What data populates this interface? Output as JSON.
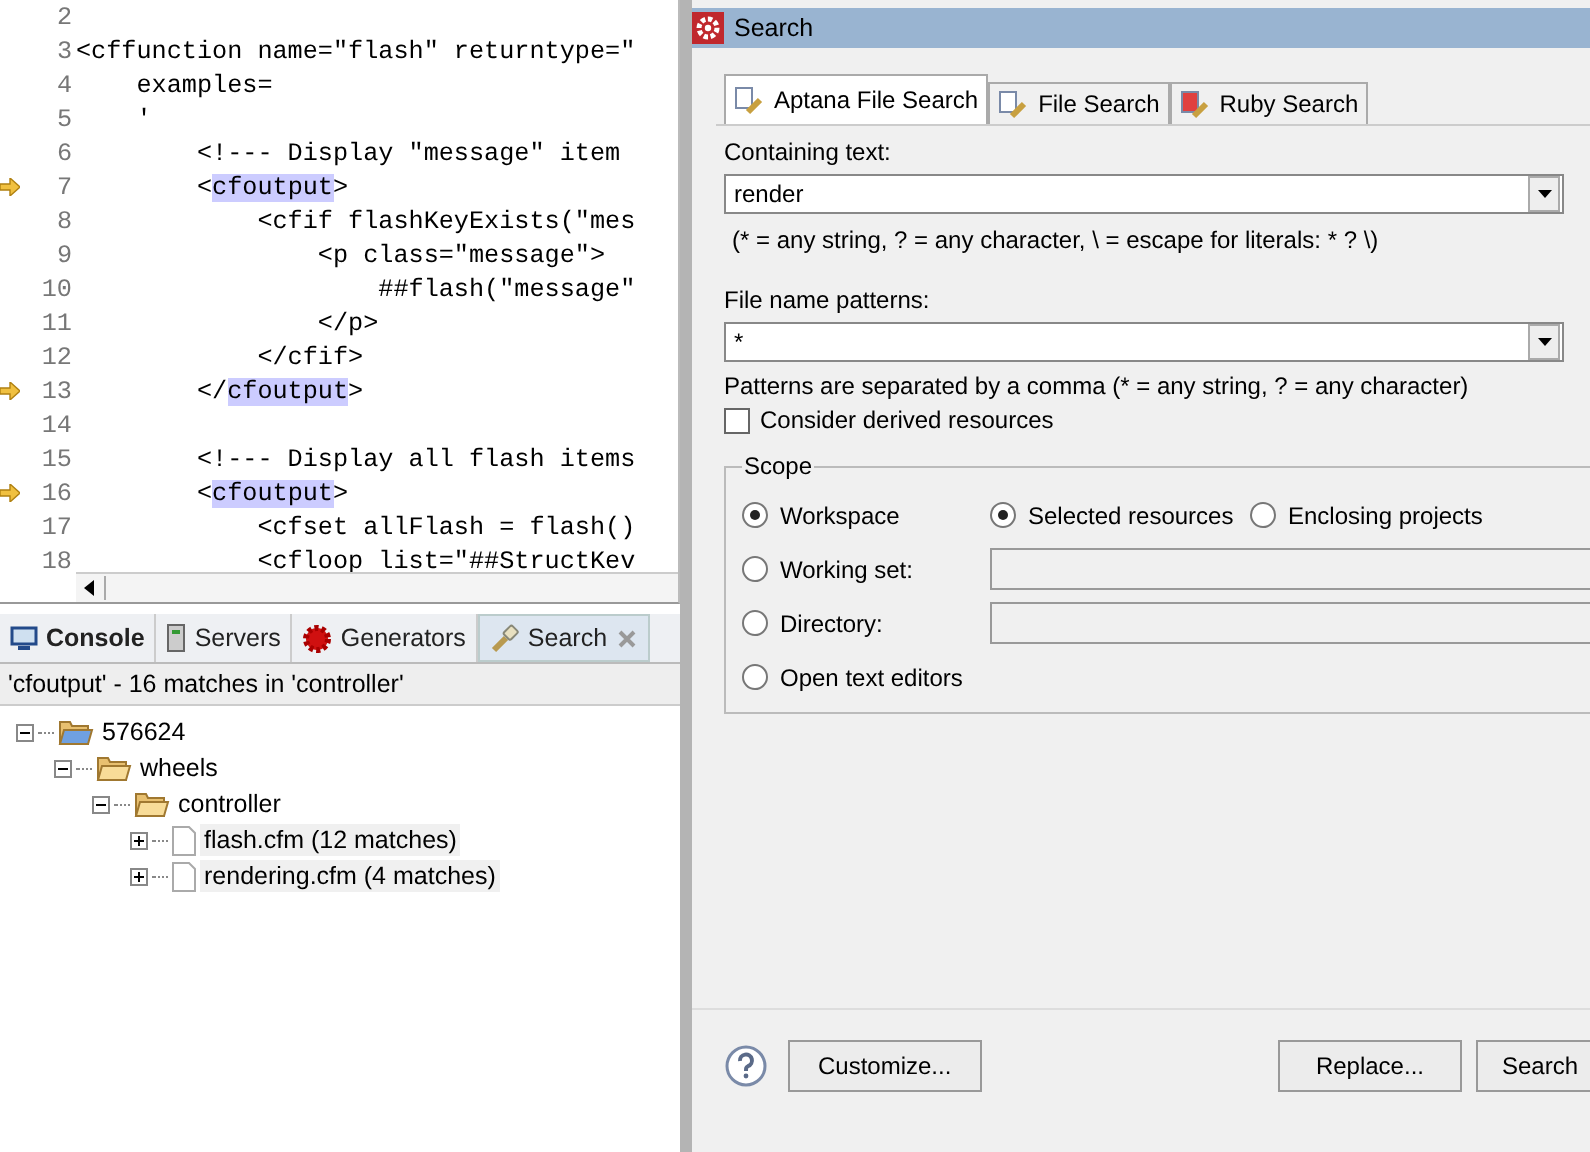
{
  "editor": {
    "lines": [
      {
        "num": "2",
        "marker": false
      },
      {
        "num": "3",
        "marker": false,
        "parts": [
          {
            "text": "<cffunction name=\"flash\" returntype=\"",
            "highlight": false
          }
        ]
      },
      {
        "num": "4",
        "marker": false,
        "parts": [
          {
            "text": "    examples=",
            "highlight": false
          }
        ]
      },
      {
        "num": "5",
        "marker": false,
        "parts": [
          {
            "text": "    '",
            "highlight": false
          }
        ]
      },
      {
        "num": "6",
        "marker": false,
        "parts": [
          {
            "text": "        <!--- Display \"message\" item",
            "highlight": false
          }
        ]
      },
      {
        "num": "7",
        "marker": true,
        "parts": [
          {
            "text": "        <",
            "highlight": false
          },
          {
            "text": "cfoutput",
            "highlight": true
          },
          {
            "text": ">",
            "highlight": false
          }
        ]
      },
      {
        "num": "8",
        "marker": false,
        "parts": [
          {
            "text": "            <cfif flashKeyExists(\"mes",
            "highlight": false
          }
        ]
      },
      {
        "num": "9",
        "marker": false,
        "parts": [
          {
            "text": "                <p class=\"message\">",
            "highlight": false
          }
        ]
      },
      {
        "num": "10",
        "marker": false,
        "parts": [
          {
            "text": "                    ##flash(\"message\"",
            "highlight": false
          }
        ]
      },
      {
        "num": "11",
        "marker": false,
        "parts": [
          {
            "text": "                </p>",
            "highlight": false
          }
        ]
      },
      {
        "num": "12",
        "marker": false,
        "parts": [
          {
            "text": "            </cfif>",
            "highlight": false
          }
        ]
      },
      {
        "num": "13",
        "marker": true,
        "parts": [
          {
            "text": "        </",
            "highlight": false
          },
          {
            "text": "cfoutput",
            "highlight": true
          },
          {
            "text": ">",
            "highlight": false
          }
        ]
      },
      {
        "num": "14",
        "marker": false
      },
      {
        "num": "15",
        "marker": false,
        "parts": [
          {
            "text": "        <!--- Display all flash items",
            "highlight": false
          }
        ]
      },
      {
        "num": "16",
        "marker": true,
        "parts": [
          {
            "text": "        <",
            "highlight": false
          },
          {
            "text": "cfoutput",
            "highlight": true
          },
          {
            "text": ">",
            "highlight": false
          }
        ]
      },
      {
        "num": "17",
        "marker": false,
        "parts": [
          {
            "text": "            <cfset allFlash = flash()",
            "highlight": false
          }
        ]
      },
      {
        "num": "18",
        "marker": false,
        "parts": [
          {
            "text": "            <cfloop list=\"##StructKev",
            "highlight": false
          }
        ]
      }
    ]
  },
  "views": {
    "tabs": [
      {
        "label": "Console",
        "kind": "console",
        "selected": false,
        "bold": true
      },
      {
        "label": "Servers",
        "kind": "servers",
        "selected": false,
        "bold": false
      },
      {
        "label": "Generators",
        "kind": "generators",
        "selected": false,
        "bold": false
      },
      {
        "label": "Search",
        "kind": "search",
        "selected": true,
        "bold": false
      }
    ],
    "summary": "'cfoutput' - 16 matches in 'controller'",
    "tree": [
      {
        "label": "576624",
        "kind": "project",
        "expanded": true,
        "children": [
          {
            "label": "wheels",
            "kind": "folder",
            "expanded": true,
            "children": [
              {
                "label": "controller",
                "kind": "folder",
                "expanded": true,
                "children": [
                  {
                    "label": "flash.cfm (12 matches)",
                    "kind": "file",
                    "expanded": false
                  },
                  {
                    "label": "rendering.cfm (4 matches)",
                    "kind": "file",
                    "expanded": false
                  }
                ]
              }
            ]
          }
        ]
      }
    ]
  },
  "dialog": {
    "title": "Search",
    "tabs": [
      {
        "label": "Aptana File Search",
        "selected": true
      },
      {
        "label": "File Search",
        "selected": false
      },
      {
        "label": "Ruby Search",
        "selected": false
      }
    ],
    "containing_label": "Containing text:",
    "containing_value": "render",
    "containing_hint": "(* = any string, ? = any character, \\ = escape for literals: * ? \\)",
    "patterns_label": "File name patterns:",
    "patterns_value": "*",
    "patterns_hint": "Patterns are separated by a comma (* = any string, ? = any character)",
    "derived": {
      "label": "Consider derived resources",
      "checked": false
    },
    "scope": {
      "title": "Scope",
      "rows": [
        {
          "radios": [
            {
              "label": "Workspace",
              "selected": true
            },
            {
              "label": "Selected resources",
              "selected": true
            },
            {
              "label": "Enclosing projects",
              "selected": false
            }
          ]
        },
        {
          "radios": [
            {
              "label": "Working set:",
              "selected": false
            }
          ],
          "field": {
            "disabled": true
          }
        },
        {
          "radios": [
            {
              "label": "Directory:",
              "selected": false
            }
          ],
          "field": {
            "disabled": true
          }
        },
        {
          "radios": [
            {
              "label": "Open text editors",
              "selected": false
            }
          ]
        }
      ]
    },
    "buttons": [
      {
        "label": "Customize...",
        "kind": "left"
      },
      {
        "label": "Replace...",
        "kind": "right"
      },
      {
        "label": "Search",
        "kind": "right"
      }
    ]
  }
}
